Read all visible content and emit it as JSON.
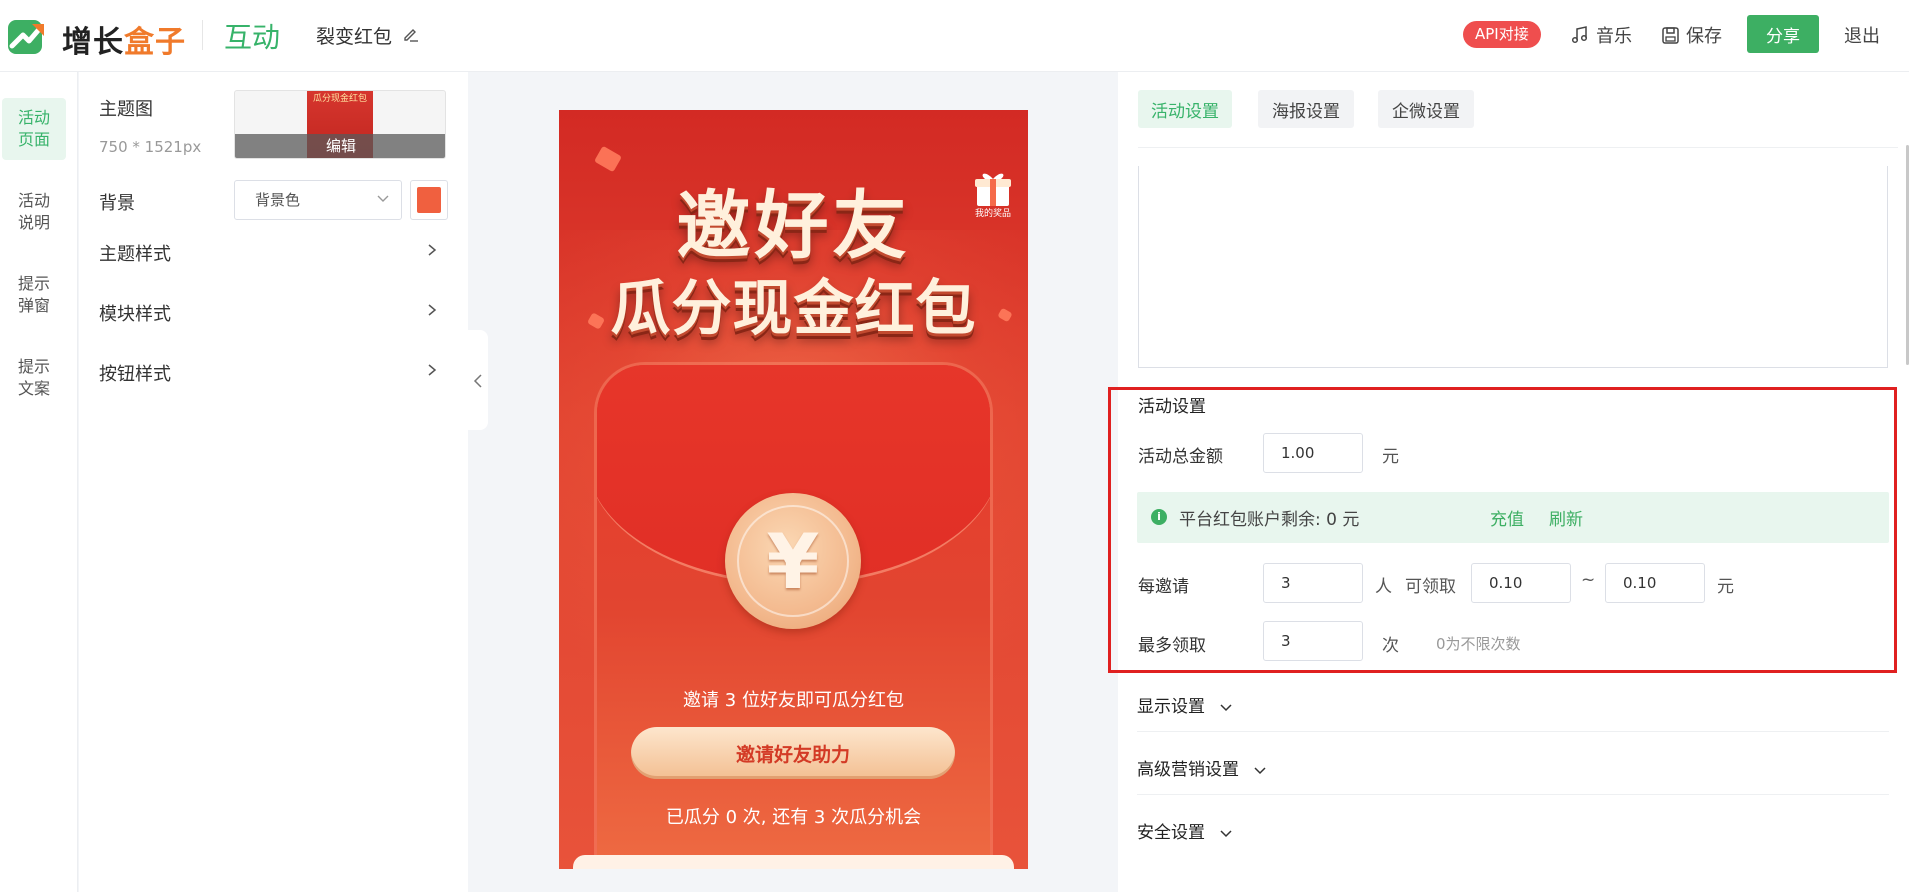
{
  "header": {
    "brand_left": "增长",
    "brand_right": "盒子",
    "app_name": "互动",
    "page_name": "裂变红包",
    "api_badge": "API对接",
    "music_label": "音乐",
    "save_label": "保存",
    "share_label": "分享",
    "exit_label": "退出"
  },
  "leftnav": {
    "items": [
      {
        "label": "活动\n页面",
        "active": true
      },
      {
        "label": "活动\n说明"
      },
      {
        "label": "提示\n弹窗"
      },
      {
        "label": "提示\n文案"
      }
    ]
  },
  "lpanel": {
    "theme_image_label": "主题图",
    "theme_image_size": "750 * 1521px",
    "thumb_text": "瓜分现金红包",
    "thumb_edit": "编辑",
    "background_label": "背景",
    "background_select": "背景色",
    "background_color": "#f0603f",
    "rows": [
      "主题样式",
      "模块样式",
      "按钮样式"
    ]
  },
  "preview": {
    "headline_1": "邀好友",
    "headline_2": "瓜分现金红包",
    "gift_label": "我的奖品",
    "coin_symbol": "¥",
    "invite_text": "邀请 3 位好友即可瓜分红包",
    "invite_button": "邀请好友助力",
    "status_text": "已瓜分 0 次, 还有 3 次瓜分机会"
  },
  "rpanel": {
    "tabs": [
      {
        "label": "活动设置",
        "active": true
      },
      {
        "label": "海报设置"
      },
      {
        "label": "企微设置"
      }
    ],
    "activity_section_title": "活动设置",
    "total_amount_label": "活动总金额",
    "total_amount_value": "1.00",
    "currency_unit": "元",
    "notice_text": "平台红包账户剩余: 0 元",
    "recharge_link": "充值",
    "refresh_link": "刷新",
    "per_invite_label": "每邀请",
    "per_invite_value": "3",
    "person_unit": "人",
    "can_receive_label": "可领取",
    "min_value": "0.10",
    "tilde": "~",
    "max_value": "0.10",
    "max_receive_label": "最多领取",
    "max_receive_value": "3",
    "times_unit": "次",
    "max_receive_hint": "0为不限次数",
    "collapse_sections": [
      "显示设置",
      "高级营销设置",
      "安全设置"
    ]
  }
}
